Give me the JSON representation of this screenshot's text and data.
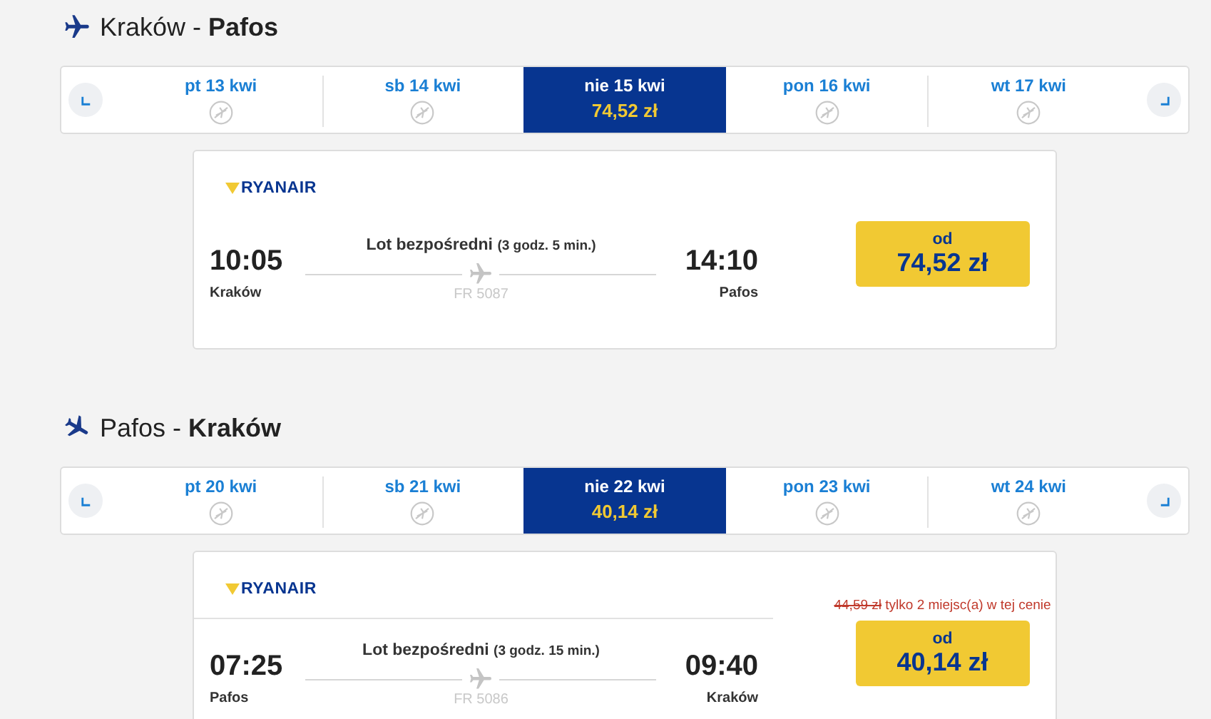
{
  "legs": [
    {
      "title": "Kraków - **Pafos**",
      "dates": [
        {
          "label": "pt 13 kwi",
          "selected": false
        },
        {
          "label": "sb 14 kwi",
          "selected": false
        },
        {
          "label": "nie 15 kwi",
          "selected": true,
          "price": "74,52 zł"
        },
        {
          "label": "pon 16 kwi",
          "selected": false
        },
        {
          "label": "wt 17 kwi",
          "selected": false
        }
      ],
      "flight": {
        "airline": "RYANAIR",
        "dep_time": "10:05",
        "dep_city": "Kraków",
        "arr_time": "14:10",
        "arr_city": "Pafos",
        "type": "Lot bezpośredni",
        "duration": "(3 godz. 5 min.)",
        "number": "FR 5087",
        "price_prefix": "od",
        "price": "74,52 zł"
      }
    },
    {
      "title": "Pafos - **Kraków**",
      "dates": [
        {
          "label": "pt 20 kwi",
          "selected": false
        },
        {
          "label": "sb 21 kwi",
          "selected": false
        },
        {
          "label": "nie 22 kwi",
          "selected": true,
          "price": "40,14 zł"
        },
        {
          "label": "pon 23 kwi",
          "selected": false
        },
        {
          "label": "wt 24 kwi",
          "selected": false
        }
      ],
      "flight": {
        "airline": "RYANAIR",
        "dep_time": "07:25",
        "dep_city": "Pafos",
        "arr_time": "09:40",
        "arr_city": "Kraków",
        "type": "Lot bezpośredni",
        "duration": "(3 godz. 15 min.)",
        "number": "FR 5086",
        "price_prefix": "od",
        "price": "40,14 zł",
        "old_price": "44,59 zł",
        "notice": "tylko 2 miejsc(a) w tej cenie"
      }
    }
  ]
}
